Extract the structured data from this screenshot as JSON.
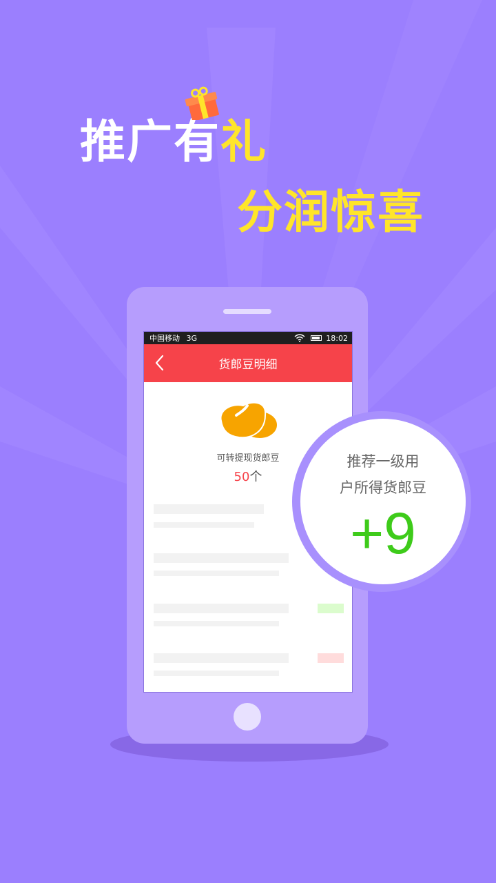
{
  "promo": {
    "line1_part1": "推广有",
    "line1_part2": "礼",
    "line2": "分润惊喜"
  },
  "status_bar": {
    "carrier": "中国移动",
    "network": "3G",
    "time": "18:02"
  },
  "app": {
    "title": "货郎豆明细",
    "bean_label": "可转提现货郎豆",
    "bean_count": "50",
    "bean_unit": "个"
  },
  "badge": {
    "line1": "推荐一级用",
    "line2": "户所得货郎豆",
    "value": "+9"
  },
  "colors": {
    "background": "#9b7ffe",
    "accent_yellow": "#ffe52a",
    "header_red": "#f6434a",
    "value_green": "#3ecb1a"
  }
}
